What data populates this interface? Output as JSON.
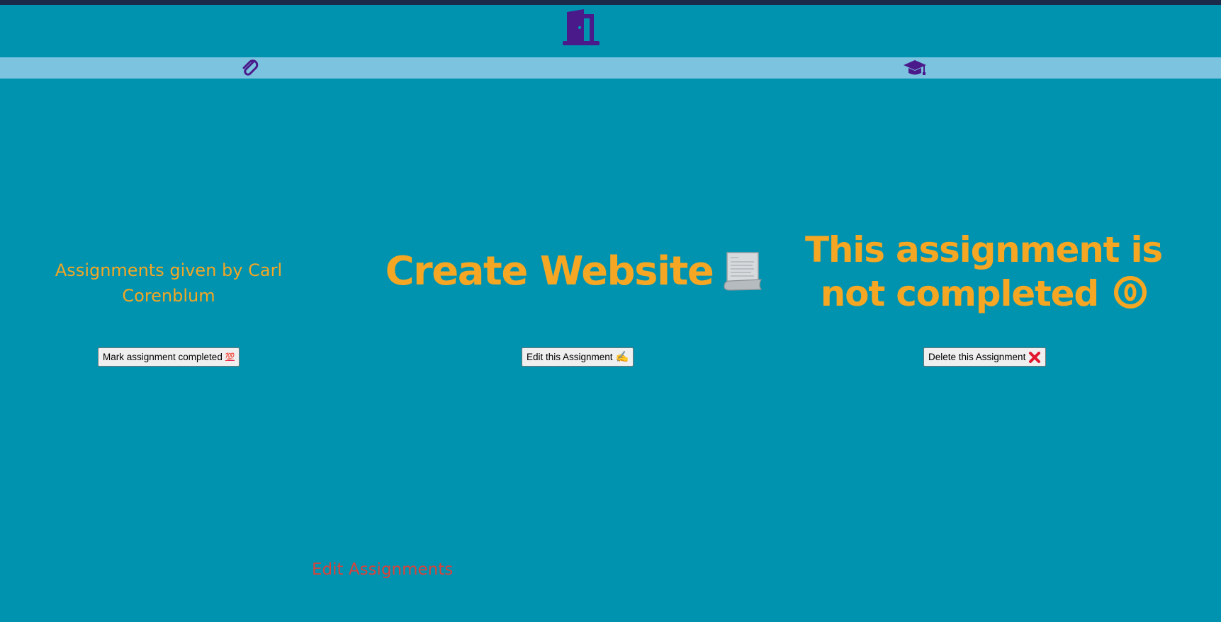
{
  "header": {
    "home_icon": "door-icon"
  },
  "nav": {
    "items": [
      {
        "icon": "paperclip-icon"
      },
      {
        "icon": "graduation-cap-icon"
      }
    ],
    "bg_color": "#7cc3e0",
    "icon_color": "#4a1a8a"
  },
  "assignment": {
    "given_by": "Assignments given by Carl Corenblum",
    "title": "Create Website",
    "title_icon": "scroll-icon",
    "status": "This assignment is not completed",
    "status_icon": "circled-zero-icon"
  },
  "actions": {
    "mark_completed": "Mark assignment completed",
    "mark_completed_emoji": "💯",
    "edit": "Edit this Assignment",
    "edit_emoji": "✍",
    "delete": "Delete this Assignment",
    "delete_emoji": "cross-mark-icon"
  },
  "footer": {
    "edit_assignments_link": "Edit Assignments"
  },
  "colors": {
    "background": "#0093b0",
    "accent": "#f5a623",
    "link": "#d9423a"
  }
}
